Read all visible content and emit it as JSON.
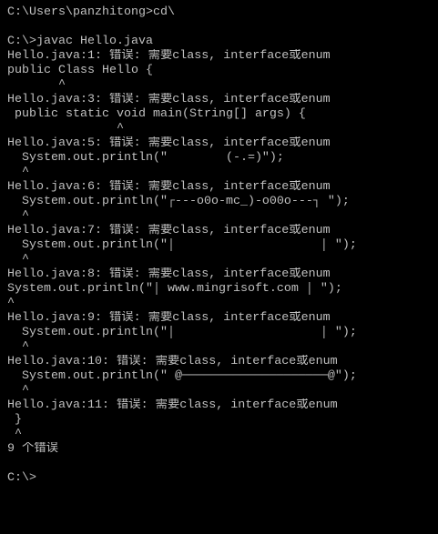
{
  "colors": {
    "background": "#000000",
    "foreground": "#c0c0c0"
  },
  "console": {
    "history_prompt": "C:\\Users\\panzhitong>cd\\",
    "command": "C:\\>javac Hello.java",
    "errors": [
      {
        "message": "Hello.java:1: 错误: 需要class, interface或enum",
        "source": "public Class Hello {",
        "caret": "       ^"
      },
      {
        "message": "Hello.java:3: 错误: 需要class, interface或enum",
        "source": " public static void main(String[] args) {",
        "caret": "               ^"
      },
      {
        "message": "Hello.java:5: 错误: 需要class, interface或enum",
        "source": "  System.out.println(\"        (-.=)\");",
        "caret": "  ^"
      },
      {
        "message": "Hello.java:6: 错误: 需要class, interface或enum",
        "source": "  System.out.println(\"┌---o0o-mc_)-o00o---┐ \");",
        "caret": "  ^"
      },
      {
        "message": "Hello.java:7: 错误: 需要class, interface或enum",
        "source": "  System.out.println(\"│                    │ \");",
        "caret": "  ^"
      },
      {
        "message": "Hello.java:8: 错误: 需要class, interface或enum",
        "source": "System.out.println(\"│ www.mingrisoft.com │ \");",
        "caret": "^"
      },
      {
        "message": "Hello.java:9: 错误: 需要class, interface或enum",
        "source": "  System.out.println(\"│                    │ \");",
        "caret": "  ^"
      },
      {
        "message": "Hello.java:10: 错误: 需要class, interface或enum",
        "source": "  System.out.println(\" @────────────────────@\");",
        "caret": "  ^"
      },
      {
        "message": "Hello.java:11: 错误: 需要class, interface或enum",
        "source": " }",
        "caret": " ^"
      }
    ],
    "summary": "9 个错误",
    "prompt": "C:\\>"
  }
}
